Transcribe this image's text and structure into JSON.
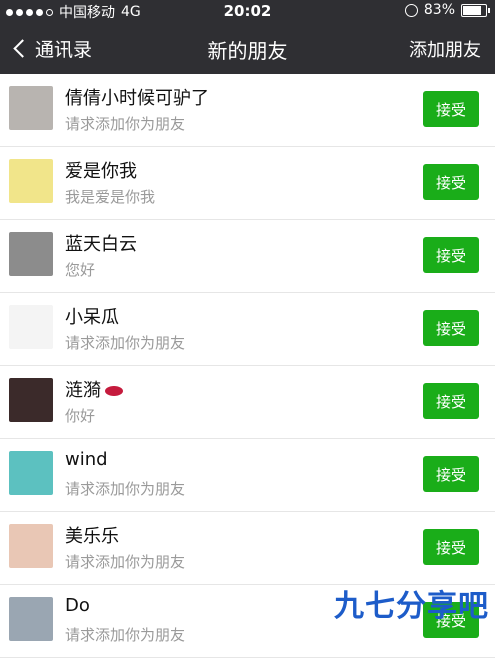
{
  "status_bar": {
    "carrier": "中国移动",
    "network": "4G",
    "time": "20:02",
    "battery": "83%",
    "battery_level": 0.83
  },
  "nav": {
    "back_label": "通讯录",
    "title": "新的朋友",
    "action_label": "添加朋友"
  },
  "requests": [
    {
      "name": "倩倩小时候可驴了",
      "message": "请求添加你为朋友",
      "button": "接受",
      "avatar_color": "#b8b4b0"
    },
    {
      "name": "爱是你我",
      "message": "我是爱是你我",
      "button": "接受",
      "avatar_color": "#f1e58a"
    },
    {
      "name": "蓝天白云",
      "message": "您好",
      "button": "接受",
      "avatar_color": "#8c8c8c"
    },
    {
      "name": "小呆瓜",
      "message": "请求添加你为朋友",
      "button": "接受",
      "avatar_color": "#f4f4f4"
    },
    {
      "name": "涟漪",
      "message": "你好",
      "button": "接受",
      "avatar_color": "#3b2a2a"
    },
    {
      "name": "wind",
      "message": "请求添加你为朋友",
      "button": "接受",
      "avatar_color": "#5cc1c0"
    },
    {
      "name": "美乐乐",
      "message": "请求添加你为朋友",
      "button": "接受",
      "avatar_color": "#e9c7b5"
    },
    {
      "name": "Do",
      "message": "请求添加你为朋友",
      "button": "接受",
      "avatar_color": "#9aa6b2"
    }
  ],
  "watermark": "九七分享吧",
  "colors": {
    "nav_bg": "#2f2f33",
    "accept_green": "#1aad19"
  }
}
